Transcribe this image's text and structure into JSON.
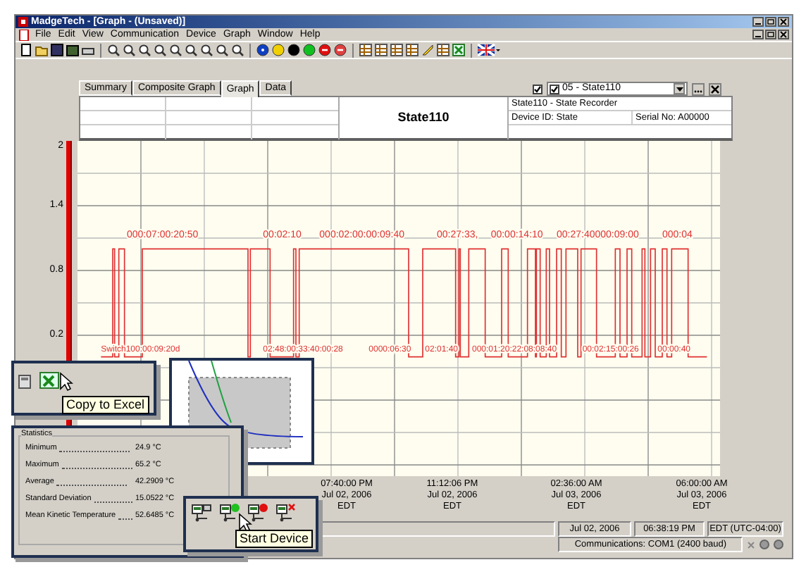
{
  "window": {
    "title": "MadgeTech - [Graph - (Unsaved)]"
  },
  "menu": [
    "File",
    "Edit",
    "View",
    "Communication",
    "Device",
    "Graph",
    "Window",
    "Help"
  ],
  "tabs": [
    {
      "label": "Summary",
      "selected": false
    },
    {
      "label": "Composite Graph",
      "selected": false
    },
    {
      "label": "Graph",
      "selected": true
    },
    {
      "label": "Data",
      "selected": false
    }
  ],
  "channel_selector": {
    "show_checked": true,
    "channel_checked": true,
    "value": "05 - State110"
  },
  "header": {
    "title": "State110",
    "device": "State110 - State Recorder",
    "device_id": "Device ID: State",
    "serial": "Serial No: A00000"
  },
  "chart": {
    "y_labels": [
      "2",
      "1.4",
      "0.8",
      "0.2"
    ],
    "top_annotations": [
      "000:07:00:20:50",
      "00:02:10",
      "000:02:00:00:09:40",
      "00:27:33,",
      "00:00:14:10",
      "00:27:40000:09:00",
      "000:04"
    ],
    "bottom_annotations": [
      "Switch100:00:09:20d",
      "02:48:00:33:40:00:28",
      "0000:06:30",
      "02:01:40",
      "000:01:20:22:08:08:40",
      "00:02:15:00:26",
      "00:00:40"
    ],
    "x_labels": [
      {
        "time": "07:40:00 PM",
        "date": "Jul 02, 2006",
        "zone": "EDT"
      },
      {
        "time": "11:12:06 PM",
        "date": "Jul 02, 2006",
        "zone": "EDT"
      },
      {
        "time": "02:36:00 AM",
        "date": "Jul 03, 2006",
        "zone": "EDT"
      },
      {
        "time": "06:00:00 AM",
        "date": "Jul 03, 2006",
        "zone": "EDT"
      }
    ]
  },
  "status_bar": {
    "date": "Jul 02, 2006",
    "time": "06:38:19 PM",
    "zone": "EDT (UTC-04:00)",
    "communications": "Communications: COM1 (2400 baud)"
  },
  "excel_callout": {
    "tooltip": "Copy to Excel"
  },
  "statistics": {
    "title": "Statistics",
    "rows": [
      {
        "label": "Minimum",
        "value": "24.9 °C"
      },
      {
        "label": "Maximum",
        "value": "65.2 °C"
      },
      {
        "label": "Average",
        "value": "42.2909 °C"
      },
      {
        "label": "Standard Deviation",
        "value": "15.0522 °C"
      },
      {
        "label": "Mean Kinetic Temperature",
        "value": "52.6485 °C"
      }
    ]
  },
  "device_callout": {
    "tooltip": "Start Device"
  }
}
